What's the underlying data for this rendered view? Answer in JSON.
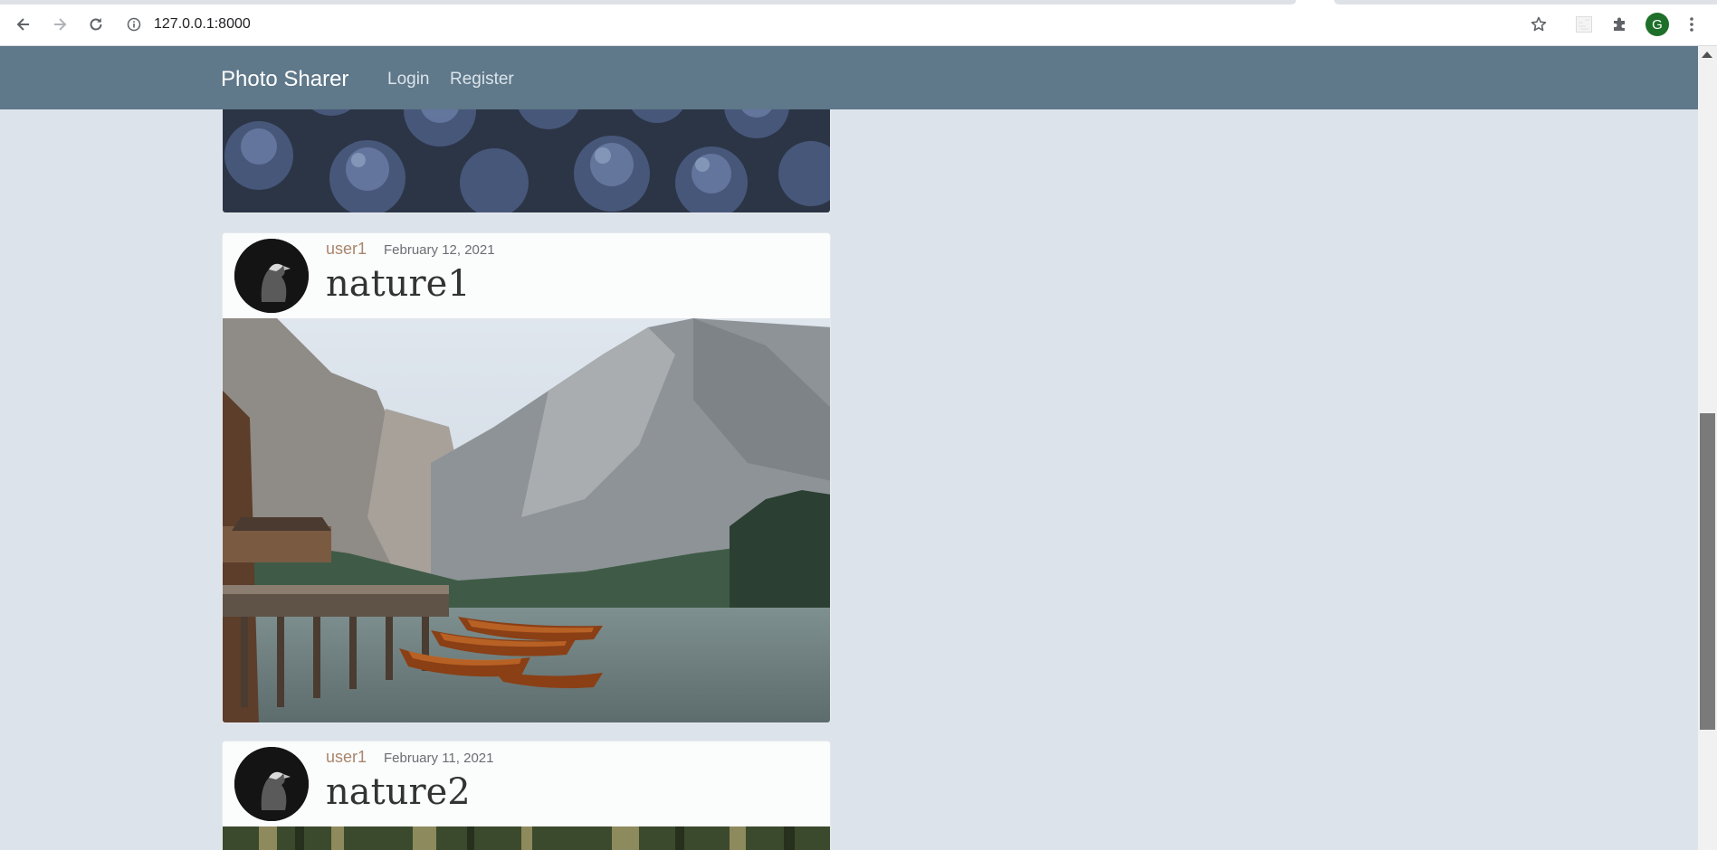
{
  "browser": {
    "url": "127.0.0.1:8000",
    "profile_initial": "G",
    "icons": [
      "back-arrow-icon",
      "forward-arrow-icon",
      "reload-icon",
      "info-icon",
      "star-icon",
      "extension-placeholder-icon",
      "puzzle-icon",
      "kebab-menu-icon"
    ]
  },
  "site": {
    "brand": "Photo Sharer",
    "nav_links": [
      "Login",
      "Register"
    ],
    "colors": {
      "navbar": "#5f788a",
      "background": "#dde3eb",
      "author": "#a9866d"
    }
  },
  "posts": [
    {
      "author": "user1",
      "date": "February 12, 2021",
      "title": "nature1"
    },
    {
      "author": "user1",
      "date": "February 11, 2021",
      "title": "nature2"
    }
  ]
}
